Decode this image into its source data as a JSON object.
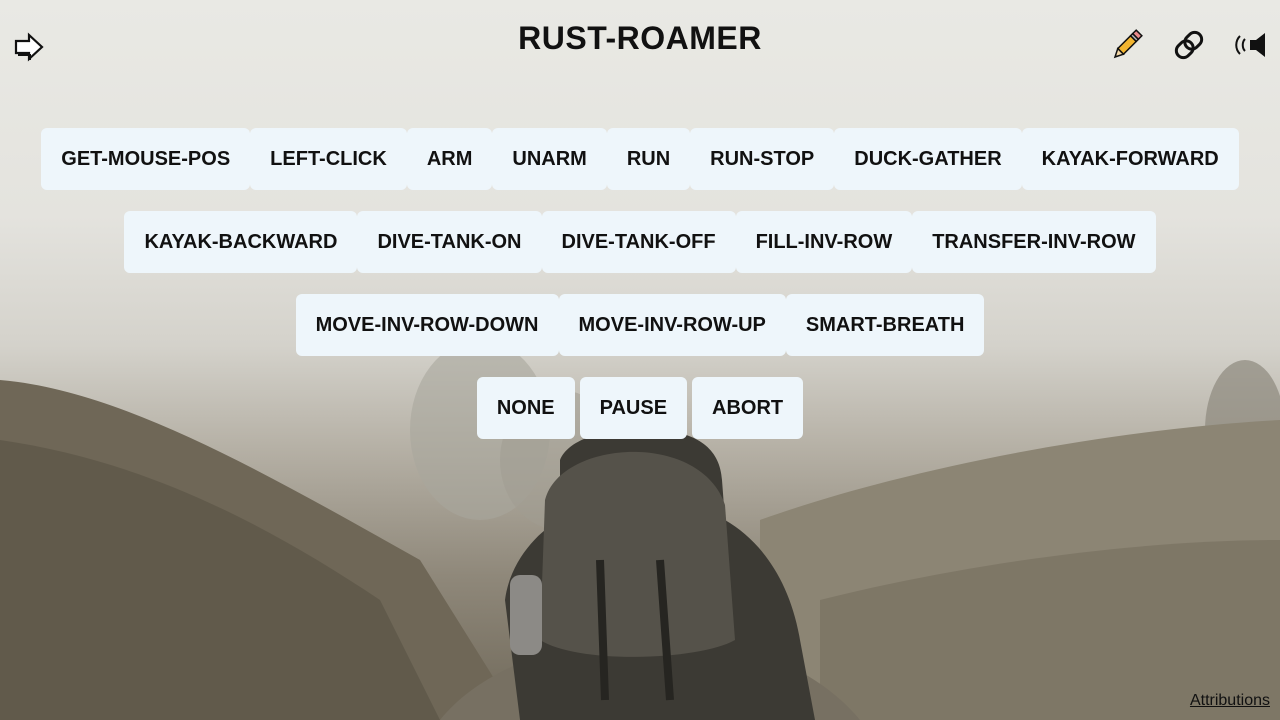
{
  "header": {
    "title": "RUST-ROAMER",
    "left_icon": "arrow-right-outline-icon",
    "right_icons": [
      "pencil-icon",
      "chain-link-icon",
      "broadcast-speaker-icon"
    ]
  },
  "buttons": {
    "row1": [
      "GET-MOUSE-POS",
      "LEFT-CLICK",
      "ARM",
      "UNARM",
      "RUN",
      "RUN-STOP",
      "DUCK-GATHER",
      "KAYAK-FORWARD"
    ],
    "row2": [
      "KAYAK-BACKWARD",
      "DIVE-TANK-ON",
      "DIVE-TANK-OFF",
      "FILL-INV-ROW",
      "TRANSFER-INV-ROW"
    ],
    "row3": [
      "MOVE-INV-ROW-DOWN",
      "MOVE-INV-ROW-UP",
      "SMART-BREATH"
    ],
    "row4": [
      "NONE",
      "PAUSE",
      "ABORT"
    ]
  },
  "footer": {
    "attributions_label": "Attributions"
  },
  "colors": {
    "button_bg": "#eef6fb",
    "text": "#111111",
    "pencil": "#f2b531"
  }
}
